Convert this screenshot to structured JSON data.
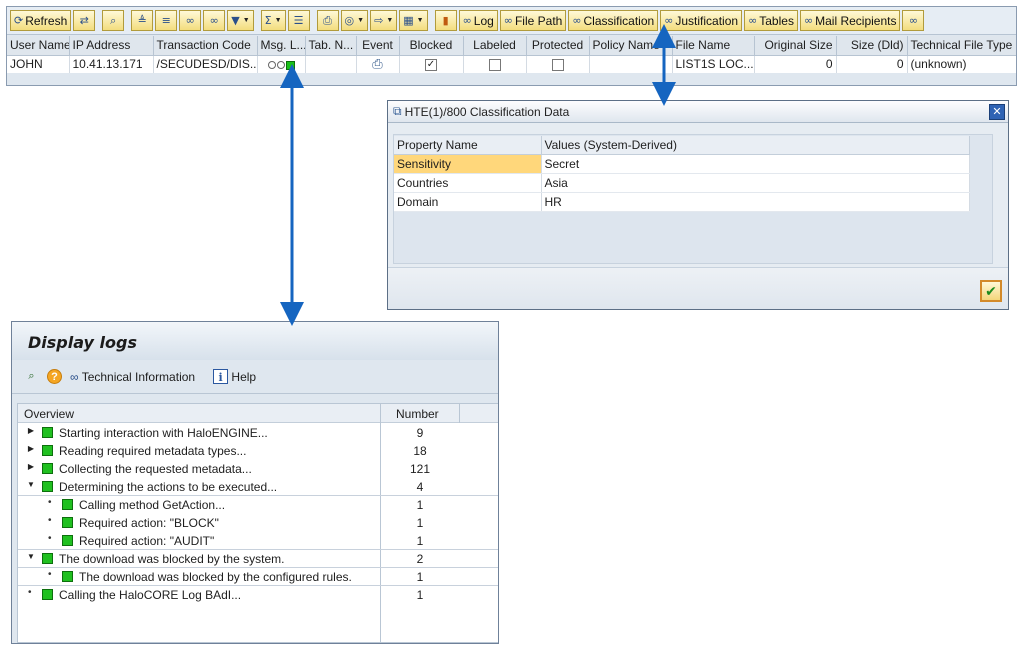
{
  "alv": {
    "toolbar": {
      "refresh_label": "Refresh",
      "log_label": "Log",
      "file_path_label": "File Path",
      "classification_label": "Classification",
      "justification_label": "Justification",
      "tables_label": "Tables",
      "mail_recipients_label": "Mail Recipients"
    },
    "columns": {
      "user_name": "User Name",
      "ip_address": "IP Address",
      "transaction_code": "Transaction Code",
      "msg_l": "Msg. L...",
      "tab_n": "Tab. N...",
      "event": "Event",
      "blocked": "Blocked",
      "labeled": "Labeled",
      "protected": "Protected",
      "policy_name": "Policy Name",
      "file_name": "File Name",
      "original_size": "Original Size",
      "size_dld": "Size (Dld)",
      "technical_file_type": "Technical File Type"
    },
    "row": {
      "user_name": "JOHN",
      "ip_address": "10.41.13.171",
      "transaction_code": "/SECUDESD/DIS...",
      "event_icon": "printer-icon",
      "blocked": "✓",
      "labeled": "",
      "protected": "",
      "file_name": "LIST1S LOC...",
      "original_size": "0",
      "size_dld": "0",
      "technical_file_type": "(unknown)"
    }
  },
  "dialog": {
    "title": "HTE(1)/800 Classification Data",
    "col_property": "Property Name",
    "col_values": "Values (System-Derived)",
    "rows": [
      {
        "property": "Sensitivity",
        "value": "Secret"
      },
      {
        "property": "Countries",
        "value": "Asia"
      },
      {
        "property": "Domain",
        "value": "HR"
      }
    ]
  },
  "logs": {
    "title": "Display logs",
    "toolbar": {
      "technical_info_label": "Technical Information",
      "help_label": "Help"
    },
    "col_overview": "Overview",
    "col_number": "Number",
    "rows": [
      {
        "text": "Starting interaction with HaloENGINE...",
        "number": "9"
      },
      {
        "text": "Reading required metadata types...",
        "number": "18"
      },
      {
        "text": "Collecting the requested metadata...",
        "number": "121"
      },
      {
        "text": "Determining the actions to be executed...",
        "number": "4"
      },
      {
        "text": "Calling method GetAction...",
        "number": "1"
      },
      {
        "text": "Required action: \"BLOCK\"",
        "number": "1"
      },
      {
        "text": "Required action: \"AUDIT\"",
        "number": "1"
      },
      {
        "text": "The download was blocked by the system.",
        "number": "2"
      },
      {
        "text": "The download was blocked by the configured rules.",
        "number": "1"
      },
      {
        "text": "Calling the HaloCORE Log BAdI...",
        "number": "1"
      }
    ]
  },
  "colors": {
    "arrow": "#1565c0",
    "status_green": "#20c020",
    "selected_cell": "#ffd77b"
  }
}
